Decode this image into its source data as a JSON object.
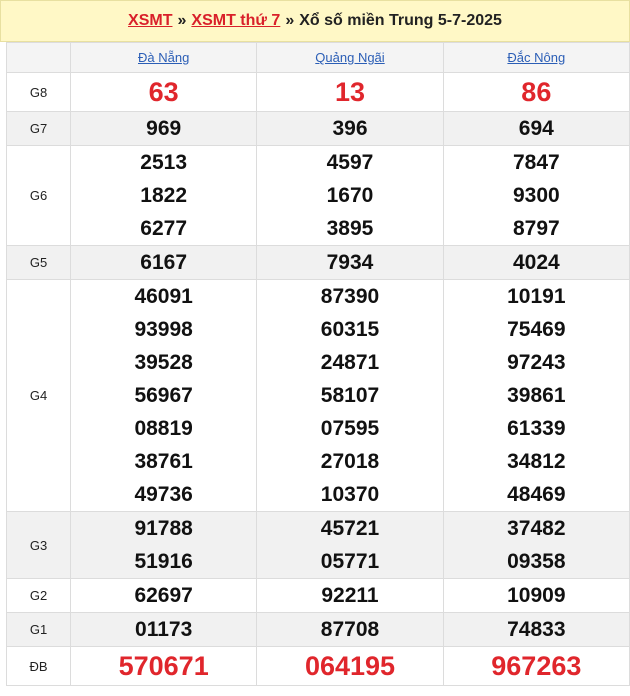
{
  "header": {
    "link1": "XSMT",
    "link2": "XSMT thứ 7",
    "sep": "»",
    "title": "Xổ số miền Trung 5-7-2025"
  },
  "provinces": [
    "Đà Nẵng",
    "Quảng Ngãi",
    "Đắc Nông"
  ],
  "rows": [
    {
      "label": "G8",
      "style": "big",
      "shade": false,
      "cols": [
        [
          "63"
        ],
        [
          "13"
        ],
        [
          "86"
        ]
      ]
    },
    {
      "label": "G7",
      "style": "num",
      "shade": true,
      "cols": [
        [
          "969"
        ],
        [
          "396"
        ],
        [
          "694"
        ]
      ]
    },
    {
      "label": "G6",
      "style": "num",
      "shade": false,
      "cols": [
        [
          "2513",
          "1822",
          "6277"
        ],
        [
          "4597",
          "1670",
          "3895"
        ],
        [
          "7847",
          "9300",
          "8797"
        ]
      ]
    },
    {
      "label": "G5",
      "style": "num",
      "shade": true,
      "cols": [
        [
          "6167"
        ],
        [
          "7934"
        ],
        [
          "4024"
        ]
      ]
    },
    {
      "label": "G4",
      "style": "num",
      "shade": false,
      "cols": [
        [
          "46091",
          "93998",
          "39528",
          "56967",
          "08819",
          "38761",
          "49736"
        ],
        [
          "87390",
          "60315",
          "24871",
          "58107",
          "07595",
          "27018",
          "10370"
        ],
        [
          "10191",
          "75469",
          "97243",
          "39861",
          "61339",
          "34812",
          "48469"
        ]
      ]
    },
    {
      "label": "G3",
      "style": "num",
      "shade": true,
      "cols": [
        [
          "91788",
          "51916"
        ],
        [
          "45721",
          "05771"
        ],
        [
          "37482",
          "09358"
        ]
      ]
    },
    {
      "label": "G2",
      "style": "num",
      "shade": false,
      "cols": [
        [
          "62697"
        ],
        [
          "92211"
        ],
        [
          "10909"
        ]
      ]
    },
    {
      "label": "G1",
      "style": "num",
      "shade": true,
      "cols": [
        [
          "01173"
        ],
        [
          "87708"
        ],
        [
          "74833"
        ]
      ]
    },
    {
      "label": "ĐB",
      "style": "big",
      "shade": false,
      "cols": [
        [
          "570671"
        ],
        [
          "064195"
        ],
        [
          "967263"
        ]
      ]
    }
  ]
}
